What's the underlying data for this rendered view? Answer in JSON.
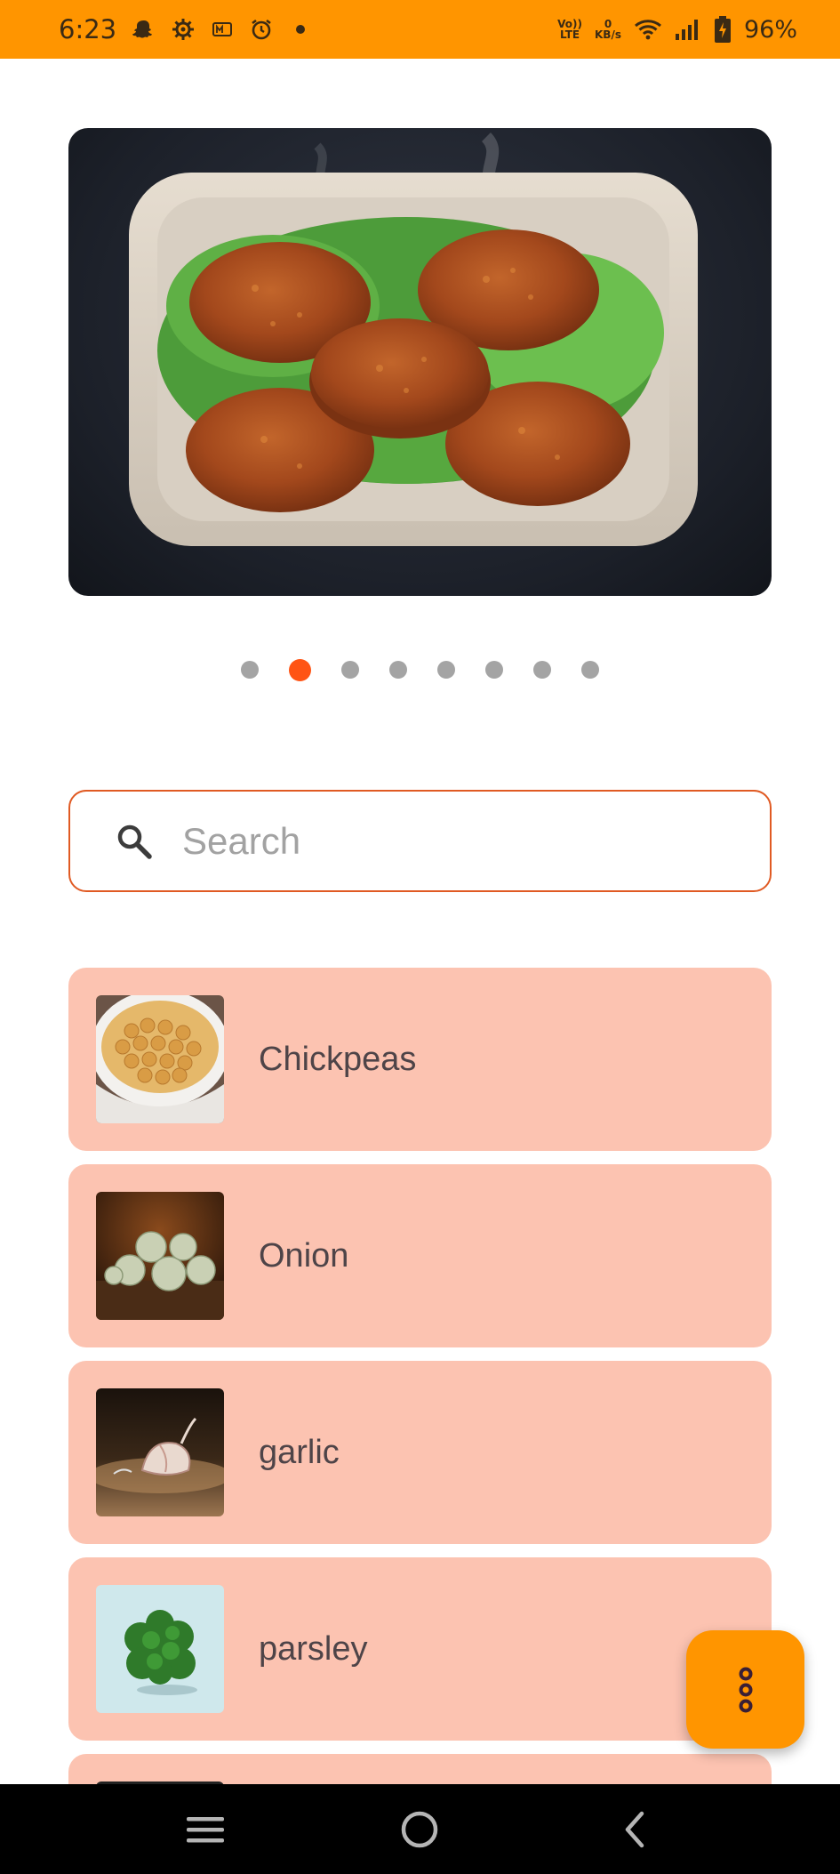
{
  "status_bar": {
    "time": "6:23",
    "volte_line1": "Vo))",
    "volte_line2": "LTE",
    "speed_value": "0",
    "speed_unit": "KB/s",
    "battery": "96%",
    "icons": [
      "snapchat-icon",
      "gear-icon",
      "m-icon",
      "alarm-icon",
      "dot-icon",
      "volte-icon",
      "wifi-icon",
      "signal-icon",
      "battery-charging-icon"
    ]
  },
  "carousel": {
    "image_desc": "falafel-patties-in-tray",
    "page_count": 8,
    "active_index": 1,
    "accent_color": "#ff5414"
  },
  "search": {
    "placeholder": "Search",
    "value": ""
  },
  "ingredients": [
    {
      "label": "Chickpeas",
      "thumb": "chickpeas-bowl"
    },
    {
      "label": "Onion",
      "thumb": "onions"
    },
    {
      "label": "garlic",
      "thumb": "garlic-clove"
    },
    {
      "label": "parsley",
      "thumb": "parsley-bunch"
    },
    {
      "label": "",
      "thumb": "partial-item"
    }
  ],
  "fab": {
    "icon": "more-vertical-icon"
  },
  "nav": {
    "icons": [
      "menu-icon",
      "home-icon",
      "back-icon"
    ]
  },
  "colors": {
    "primary": "#ff9500",
    "accent": "#ff5414",
    "card": "#fcc3b1",
    "search_border": "#e05a23"
  }
}
